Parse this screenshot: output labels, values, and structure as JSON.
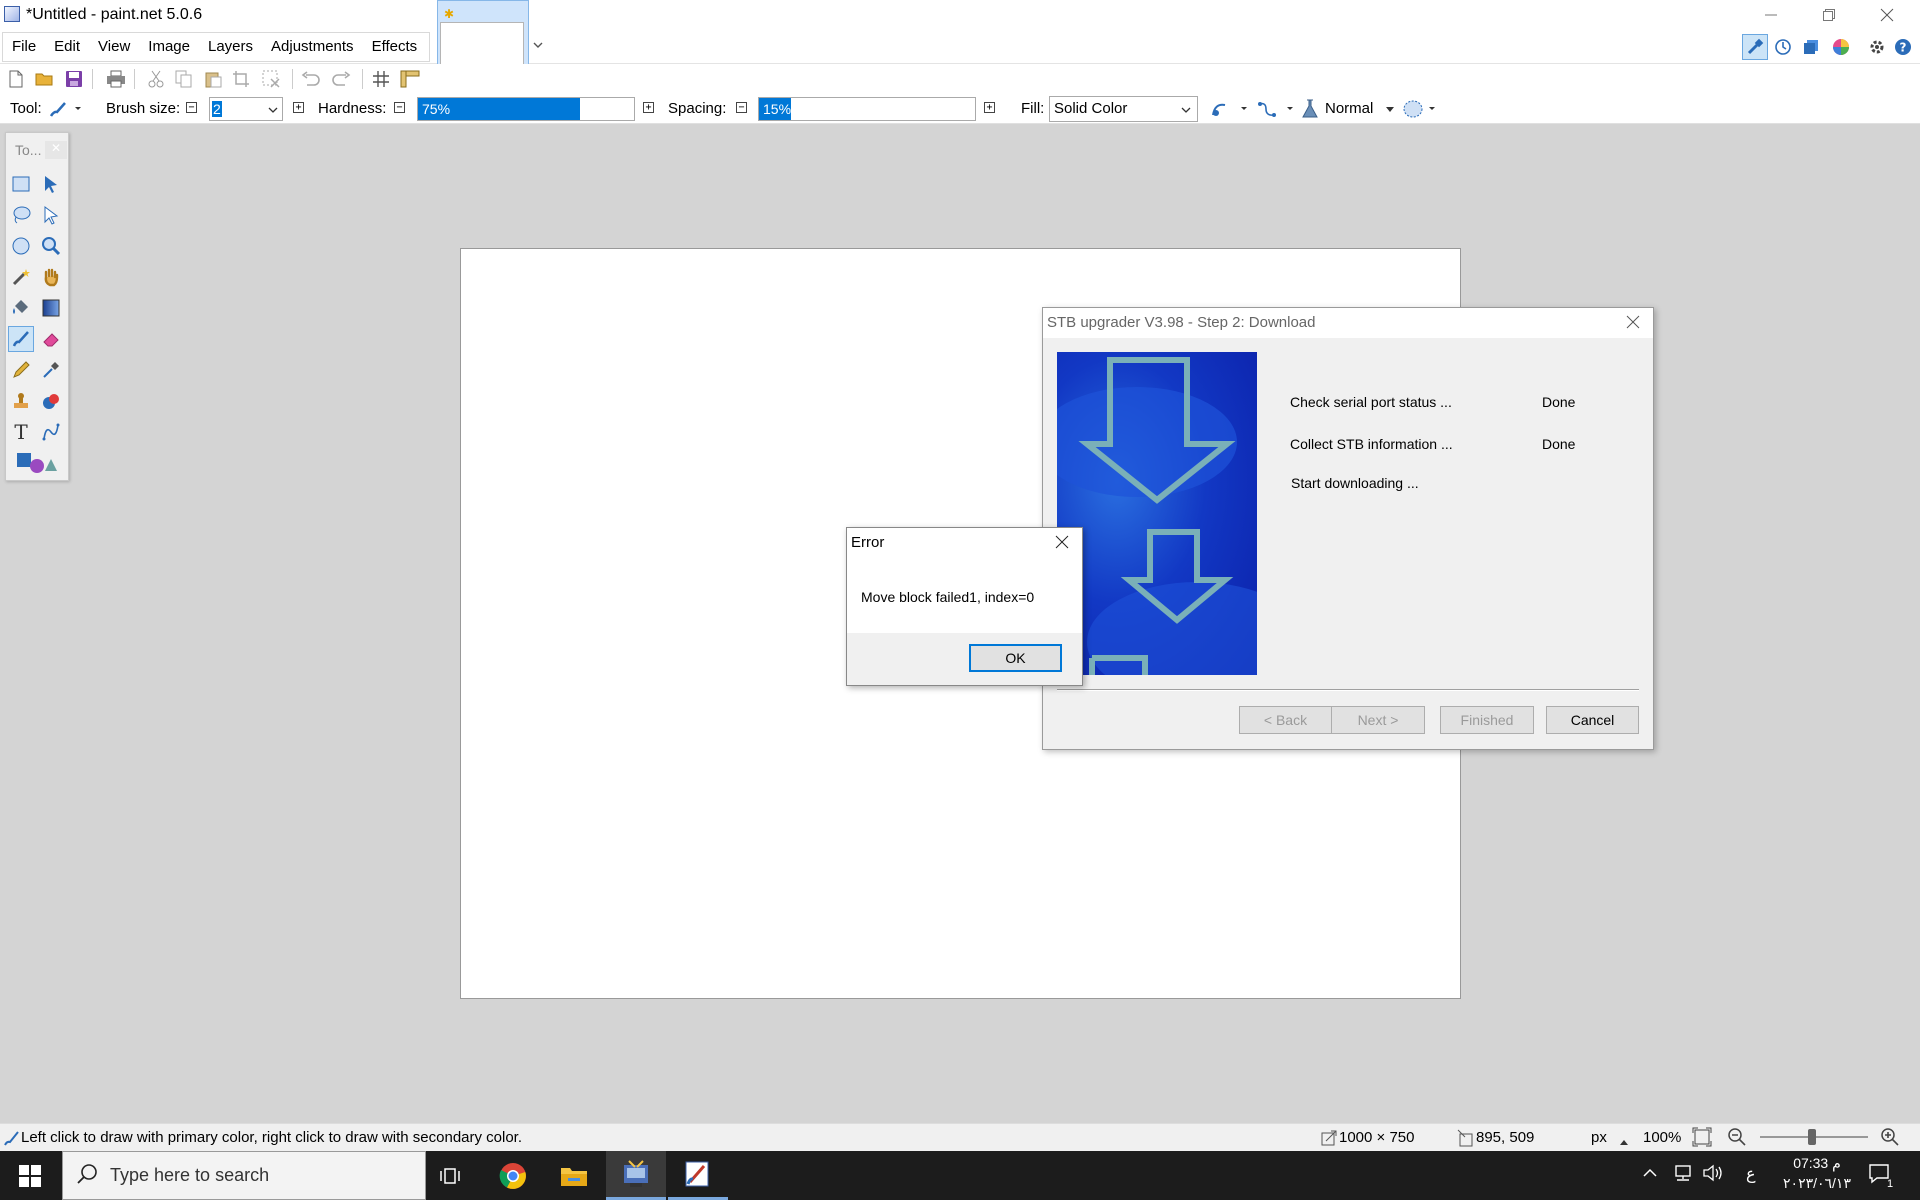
{
  "window": {
    "title": "*Untitled - paint.net 5.0.6",
    "controls": [
      "minimize",
      "restore",
      "close"
    ]
  },
  "menu": [
    "File",
    "Edit",
    "View",
    "Image",
    "Layers",
    "Adjustments",
    "Effects"
  ],
  "toolbar_right_icons": [
    "tools-icon",
    "history-icon",
    "layers-icon",
    "colors-icon",
    "settings-icon",
    "help-icon"
  ],
  "options": {
    "tool_label": "Tool:",
    "brush_size_label": "Brush size:",
    "brush_size_value": "2",
    "hardness_label": "Hardness:",
    "hardness_value": "75%",
    "hardness_fraction": 0.75,
    "spacing_label": "Spacing:",
    "spacing_value": "15%",
    "spacing_fraction": 0.15,
    "fill_label": "Fill:",
    "fill_value": "Solid Color",
    "blend_mode": "Normal"
  },
  "tools_panel": {
    "title": "To..."
  },
  "stb_dialog": {
    "title": "STB upgrader V3.98 - Step 2: Download",
    "steps": [
      {
        "label": "Check serial port status ...",
        "status": "Done"
      },
      {
        "label": "Collect STB information ...",
        "status": "Done"
      },
      {
        "label": "Start downloading ...",
        "status": ""
      }
    ],
    "buttons": {
      "back": "< Back",
      "next": "Next >",
      "finished": "Finished",
      "cancel": "Cancel"
    }
  },
  "error_dialog": {
    "title": "Error",
    "message": "Move block failed1, index=0",
    "ok": "OK"
  },
  "status": {
    "hint": "Left click to draw with primary color, right click to draw with secondary color.",
    "image_size": "1000 × 750",
    "cursor_position": "895, 509",
    "unit": "px",
    "zoom": "100%"
  },
  "taskbar": {
    "search_placeholder": "Type here to search",
    "time": "07:33 م",
    "date": "٢٠٢٣/٠٦/١٣",
    "language": "ع",
    "notification_count": "1"
  }
}
